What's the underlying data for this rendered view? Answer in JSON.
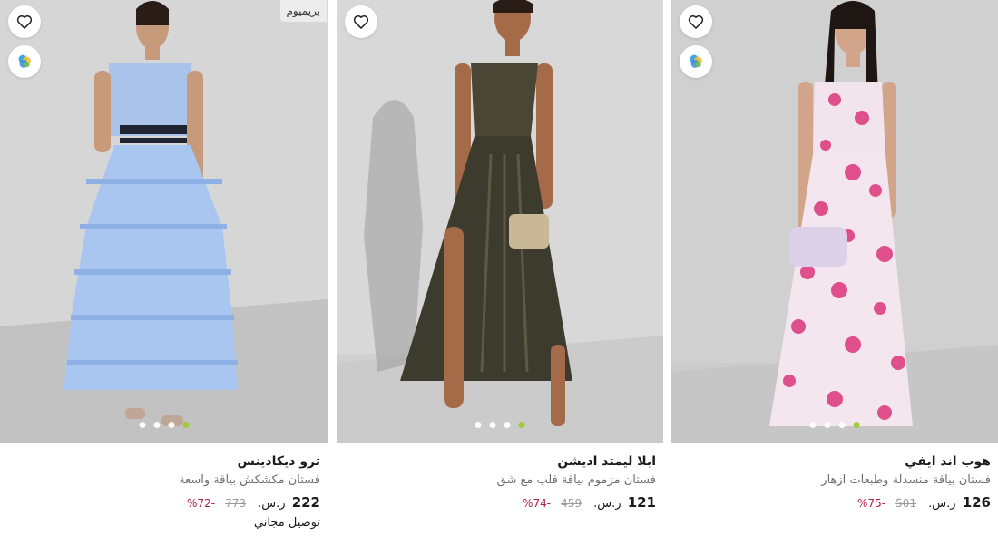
{
  "colors": {
    "accent_dot": "#9acd2d",
    "discount": "#b01c4a",
    "text_primary": "#1a1a1a",
    "text_secondary": "#6d6d6d"
  },
  "icons": {
    "wishlist": "heart-icon",
    "similar": "similar-items-icon"
  },
  "products": [
    {
      "badge": "بريميوم",
      "brand": "ترو ديكادينس",
      "title": "فستان مكشكش بياقة واسعة",
      "price": "222",
      "currency": "ر.س.",
      "old_price": "773",
      "discount": "-72%",
      "shipping": "توصيل مجاني",
      "image_dots": 4,
      "active_dot": 3
    },
    {
      "badge": "",
      "brand": "ابلا ليمتد اديشن",
      "title": "فستان مزموم بياقة قلب مع شق",
      "price": "121",
      "currency": "ر.س.",
      "old_price": "459",
      "discount": "-74%",
      "shipping": "",
      "image_dots": 4,
      "active_dot": 3
    },
    {
      "badge": "",
      "brand": "هوب اند ايفي",
      "title": "فستان بياقة منسدلة وطبعات ازهار",
      "price": "126",
      "currency": "ر.س.",
      "old_price": "501",
      "discount": "-75%",
      "shipping": "",
      "image_dots": 4,
      "active_dot": 3
    }
  ]
}
